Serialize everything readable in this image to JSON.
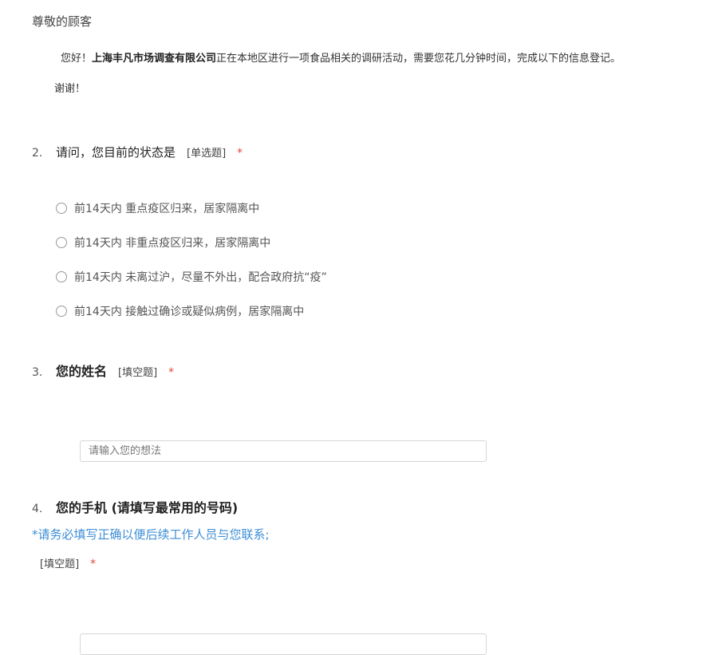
{
  "greeting": "尊敬的顾客",
  "intro": {
    "prefix": "您好！",
    "company": "上海丰凡市场调查有限公司",
    "body": "正在本地区进行一项食品相关的调研活动，需要您花几分钟时间，完成以下的信息登记。"
  },
  "thanks": "谢谢！",
  "questions": [
    {
      "number": "2.",
      "title": "请问，您目前的状态是",
      "type": "[单选题]",
      "required": "*",
      "options": [
        "前14天内 重点疫区归来，居家隔离中",
        "前14天内 非重点疫区归来，居家隔离中",
        "前14天内 未离过沪，尽量不外出，配合政府抗“疫”",
        "前14天内 接触过确诊或疑似病例，居家隔离中"
      ]
    },
    {
      "number": "3.",
      "title": "您的姓名",
      "type": "[填空题]",
      "required": "*",
      "input": {
        "value": "",
        "placeholder": "请输入您的想法"
      }
    },
    {
      "number": "4.",
      "title": "您的手机 (请填写最常用的号码)",
      "note": "*请务必填写正确以便后续工作人员与您联系;",
      "type": "[填空题]",
      "required": "*",
      "input": {
        "value": "",
        "placeholder": ""
      }
    }
  ],
  "colors": {
    "required": "#e0493b",
    "note": "#3d8ed6"
  }
}
